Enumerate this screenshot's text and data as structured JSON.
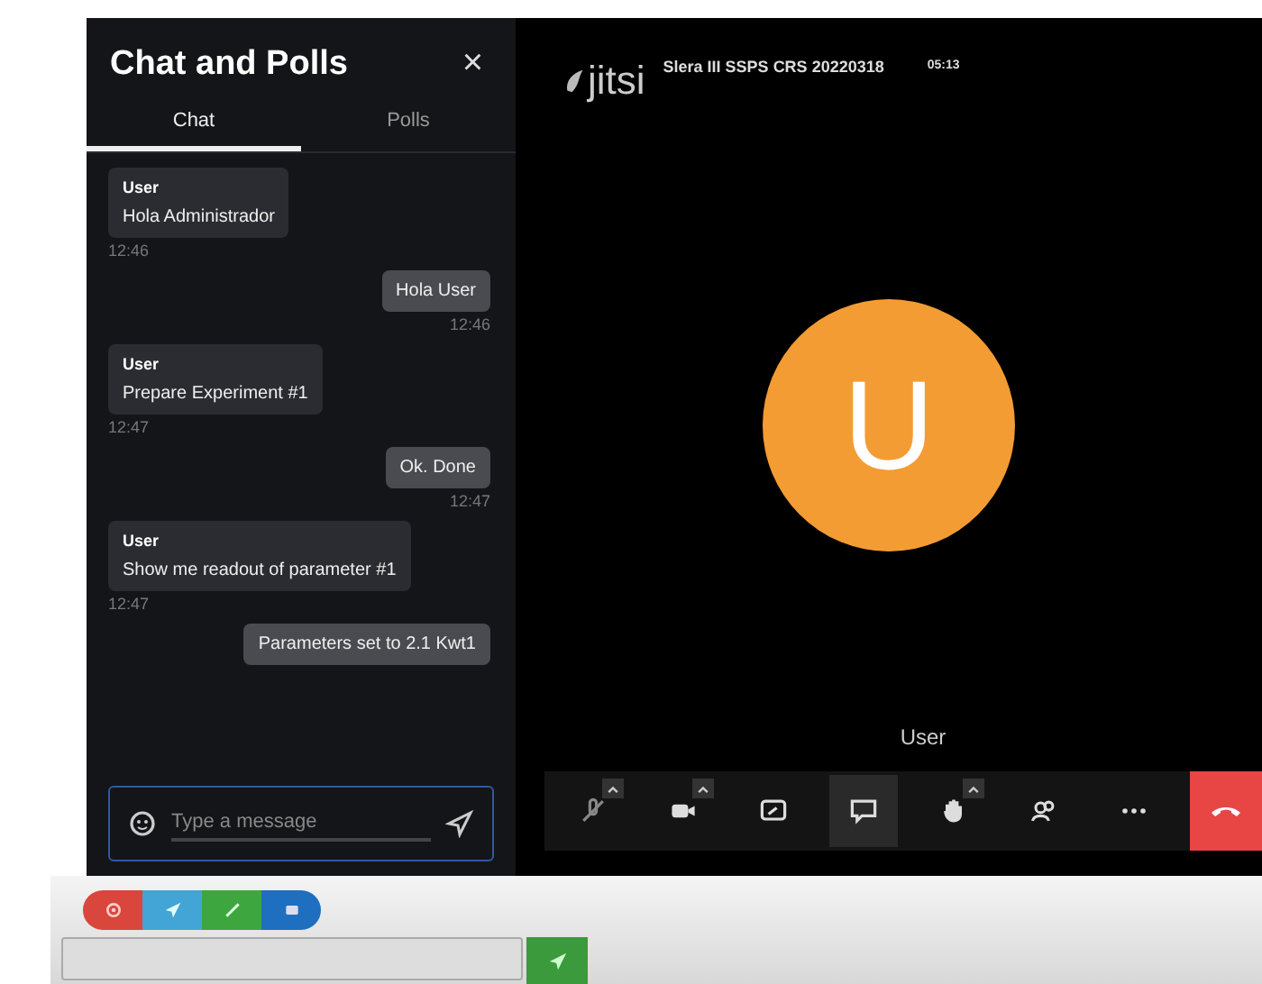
{
  "chat_panel": {
    "title": "Chat and Polls",
    "close": "×",
    "tabs": [
      {
        "label": "Chat",
        "selected": true
      },
      {
        "label": "Polls",
        "selected": false
      }
    ],
    "messages": [
      {
        "kind": "received",
        "sender": "User",
        "text": "Hola Administrador",
        "time": "12:46"
      },
      {
        "kind": "sent",
        "text": "Hola User",
        "time": "12:46"
      },
      {
        "kind": "received",
        "sender": "User",
        "text": "Prepare Experiment #1",
        "time": "12:47"
      },
      {
        "kind": "sent",
        "text": "Ok. Done",
        "time": "12:47"
      },
      {
        "kind": "received",
        "sender": "User",
        "text": "Show me readout of parameter #1",
        "time": "12:47"
      },
      {
        "kind": "sent",
        "text": "Parameters set to 2.1 Kwt1"
      }
    ],
    "composer": {
      "placeholder": "Type a message"
    }
  },
  "meeting": {
    "logo": "jitsi",
    "title": "Slera III SSPS CRS 20220318",
    "timer": "05:13",
    "avatar_letter": "U",
    "participant": "User",
    "toolbar": [
      {
        "kind": "mic",
        "caret": true,
        "selected": false
      },
      {
        "kind": "camera",
        "caret": true,
        "selected": false
      },
      {
        "kind": "share",
        "caret": false,
        "selected": false
      },
      {
        "kind": "chat",
        "caret": false,
        "selected": true
      },
      {
        "kind": "hand",
        "caret": true,
        "selected": false
      },
      {
        "kind": "participants",
        "caret": false,
        "selected": false
      },
      {
        "kind": "more",
        "caret": false,
        "selected": false
      },
      {
        "kind": "hangup",
        "caret": false,
        "selected": false
      }
    ]
  },
  "host_bar": {
    "buttons": [
      {
        "kind": "power",
        "color": "#d9463b"
      },
      {
        "kind": "send",
        "color": "#42a5d6"
      },
      {
        "kind": "expand",
        "color": "#3da63f"
      },
      {
        "kind": "video",
        "color": "#1e6fc0"
      }
    ]
  }
}
